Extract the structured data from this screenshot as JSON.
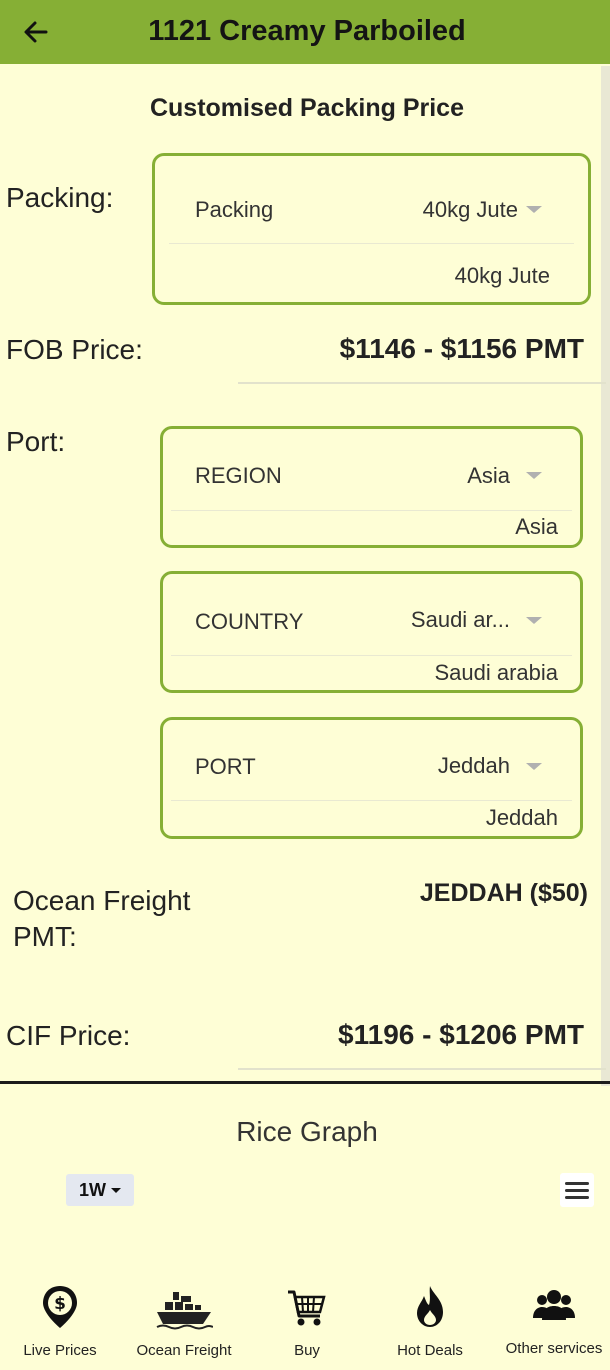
{
  "header": {
    "title": "1121 Creamy Parboiled",
    "back_icon": "arrow-left-icon"
  },
  "section_title": "Customised Packing Price",
  "packing": {
    "label": "Packing:",
    "select_label": "Packing",
    "select_value": "40kg Jute",
    "current": "40kg Jute"
  },
  "fob": {
    "label": "FOB Price:",
    "value": "$1146 - $1156 PMT"
  },
  "port": {
    "label": "Port:",
    "region": {
      "label": "REGION",
      "value": "Asia",
      "current": "Asia"
    },
    "country": {
      "label": "COUNTRY",
      "value": "Saudi ar...",
      "current": "Saudi arabia"
    },
    "port": {
      "label": "PORT",
      "value": "Jeddah",
      "current": "Jeddah"
    }
  },
  "ocean_freight": {
    "label_line1": "Ocean Freight",
    "label_line2": "PMT:",
    "value": "JEDDAH ($50)"
  },
  "cif": {
    "label": "CIF Price:",
    "value": "$1196 - $1206 PMT"
  },
  "graph": {
    "title": "Rice Graph",
    "range": "1W",
    "menu_icon": "hamburger-menu-icon"
  },
  "nav": {
    "items": [
      {
        "label": "Live Prices",
        "icon": "dollar-pin-icon"
      },
      {
        "label": "Ocean Freight",
        "icon": "ship-icon"
      },
      {
        "label": "Buy",
        "icon": "cart-icon"
      },
      {
        "label": "Hot Deals",
        "icon": "fire-icon"
      },
      {
        "label": "Other services",
        "icon": "users-icon"
      }
    ]
  },
  "colors": {
    "accent": "#86af35",
    "background": "#fefed6"
  }
}
